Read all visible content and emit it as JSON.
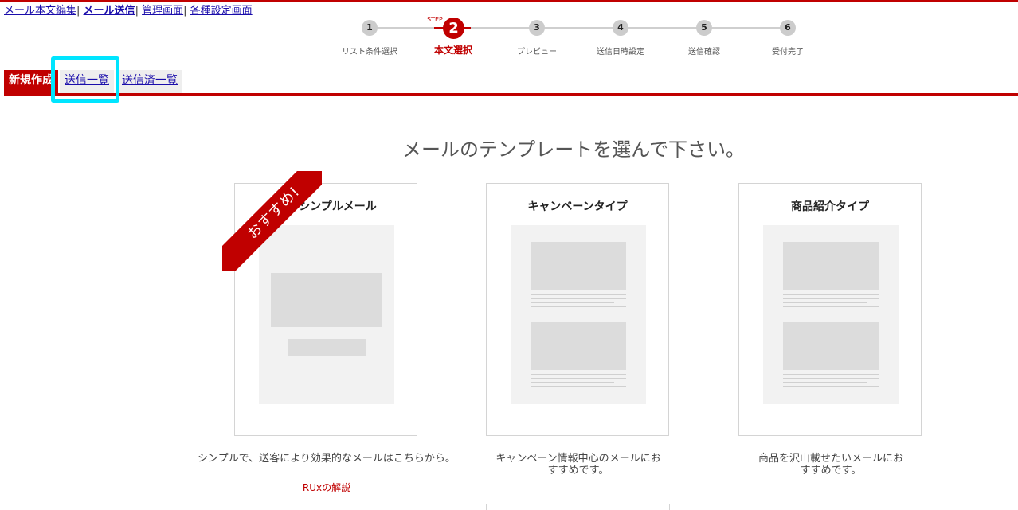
{
  "top_nav": {
    "items": [
      {
        "label": "メール本文編集",
        "bold": false
      },
      {
        "label": "メール送信",
        "bold": true
      },
      {
        "label": "管理画面",
        "bold": false
      },
      {
        "label": "各種設定画面",
        "bold": false
      }
    ],
    "separator": "|"
  },
  "stepper": {
    "tag": "STEP",
    "steps": [
      {
        "number": "1",
        "label": "リスト条件選択"
      },
      {
        "number": "2",
        "label": "本文選択"
      },
      {
        "number": "3",
        "label": "プレビュー"
      },
      {
        "number": "4",
        "label": "送信日時設定"
      },
      {
        "number": "5",
        "label": "送信確認"
      },
      {
        "number": "6",
        "label": "受付完了"
      }
    ],
    "current_step": 2
  },
  "tabs": {
    "new": "新規作成",
    "send_list": "送信一覧",
    "sent_list": "送信済一覧"
  },
  "main": {
    "heading": "メールのテンプレートを選んで下さい。",
    "ribbon": "おすすめ!",
    "cards": [
      {
        "title": "シンプルメール",
        "desc": "シンプルで、送客により効果的なメールはこちらから。",
        "link": "RUxの解説"
      },
      {
        "title": "キャンペーンタイプ",
        "desc": "キャンペーン情報中心のメールにおすすめです。"
      },
      {
        "title": "商品紹介タイプ",
        "desc": "商品を沢山載せたいメールにおすすめです。"
      }
    ]
  },
  "colors": {
    "accent": "#c00000",
    "highlight": "#00e5ff",
    "link": "#1a0dab"
  }
}
